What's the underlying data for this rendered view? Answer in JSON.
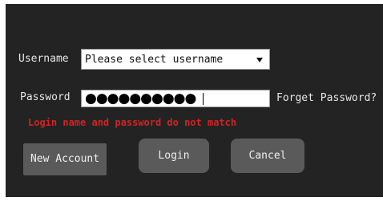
{
  "form": {
    "username_label": "Username",
    "username_value": "Please select username",
    "password_label": "Password",
    "password_value": "●●●●●●●●●●",
    "forgot_label": "Forget Password?",
    "error_text": "Login name and password do not match"
  },
  "buttons": {
    "new_account": "New Account",
    "login": "Login",
    "cancel": "Cancel"
  },
  "colors": {
    "panel": "#232323",
    "button": "#5a5a5a",
    "error": "#d22323"
  },
  "icons": {
    "dropdown": "chevron-down-icon"
  }
}
